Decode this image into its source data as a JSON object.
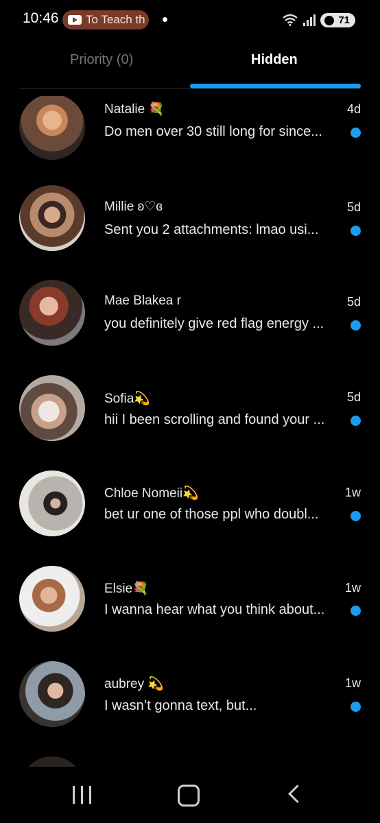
{
  "status_bar": {
    "time": "10:46",
    "notification_pill_text": "To Teach th",
    "notification_icon": "youtube-icon",
    "wifi_icon": "wifi-icon",
    "signal_icon": "signal-icon",
    "battery": "71"
  },
  "tabs": [
    {
      "label": "Priority (0)",
      "active": false
    },
    {
      "label": "Hidden",
      "active": true
    }
  ],
  "accent_color": "#1d9bf0",
  "conversations": [
    {
      "name": "Natalie 💐",
      "time": "4d",
      "preview": "Do men over 30 still long for since...",
      "unread": true
    },
    {
      "name": "Millie ʚ♡ɞ",
      "time": "5d",
      "preview": "Sent you 2 attachments: lmao usi...",
      "unread": true
    },
    {
      "name": "Mae Blakea r",
      "time": "5d",
      "preview": "you definitely give red flag energy ...",
      "unread": true
    },
    {
      "name": "Sofia💫",
      "time": "5d",
      "preview": "hii I been scrolling and found your ...",
      "unread": true
    },
    {
      "name": "Chloe Nomeii💫",
      "time": "1w",
      "preview": "bet ur one of those ppl who doubl...",
      "unread": true
    },
    {
      "name": "Elsie💐",
      "time": "1w",
      "preview": "I wanna hear what you think about...",
      "unread": true
    },
    {
      "name": "aubrey 💫",
      "time": "1w",
      "preview": "I wasn’t gonna text, but...",
      "unread": true
    }
  ],
  "nav_bar": {
    "recents_icon": "recents-icon",
    "home_icon": "home-icon",
    "back_icon": "back-icon"
  }
}
